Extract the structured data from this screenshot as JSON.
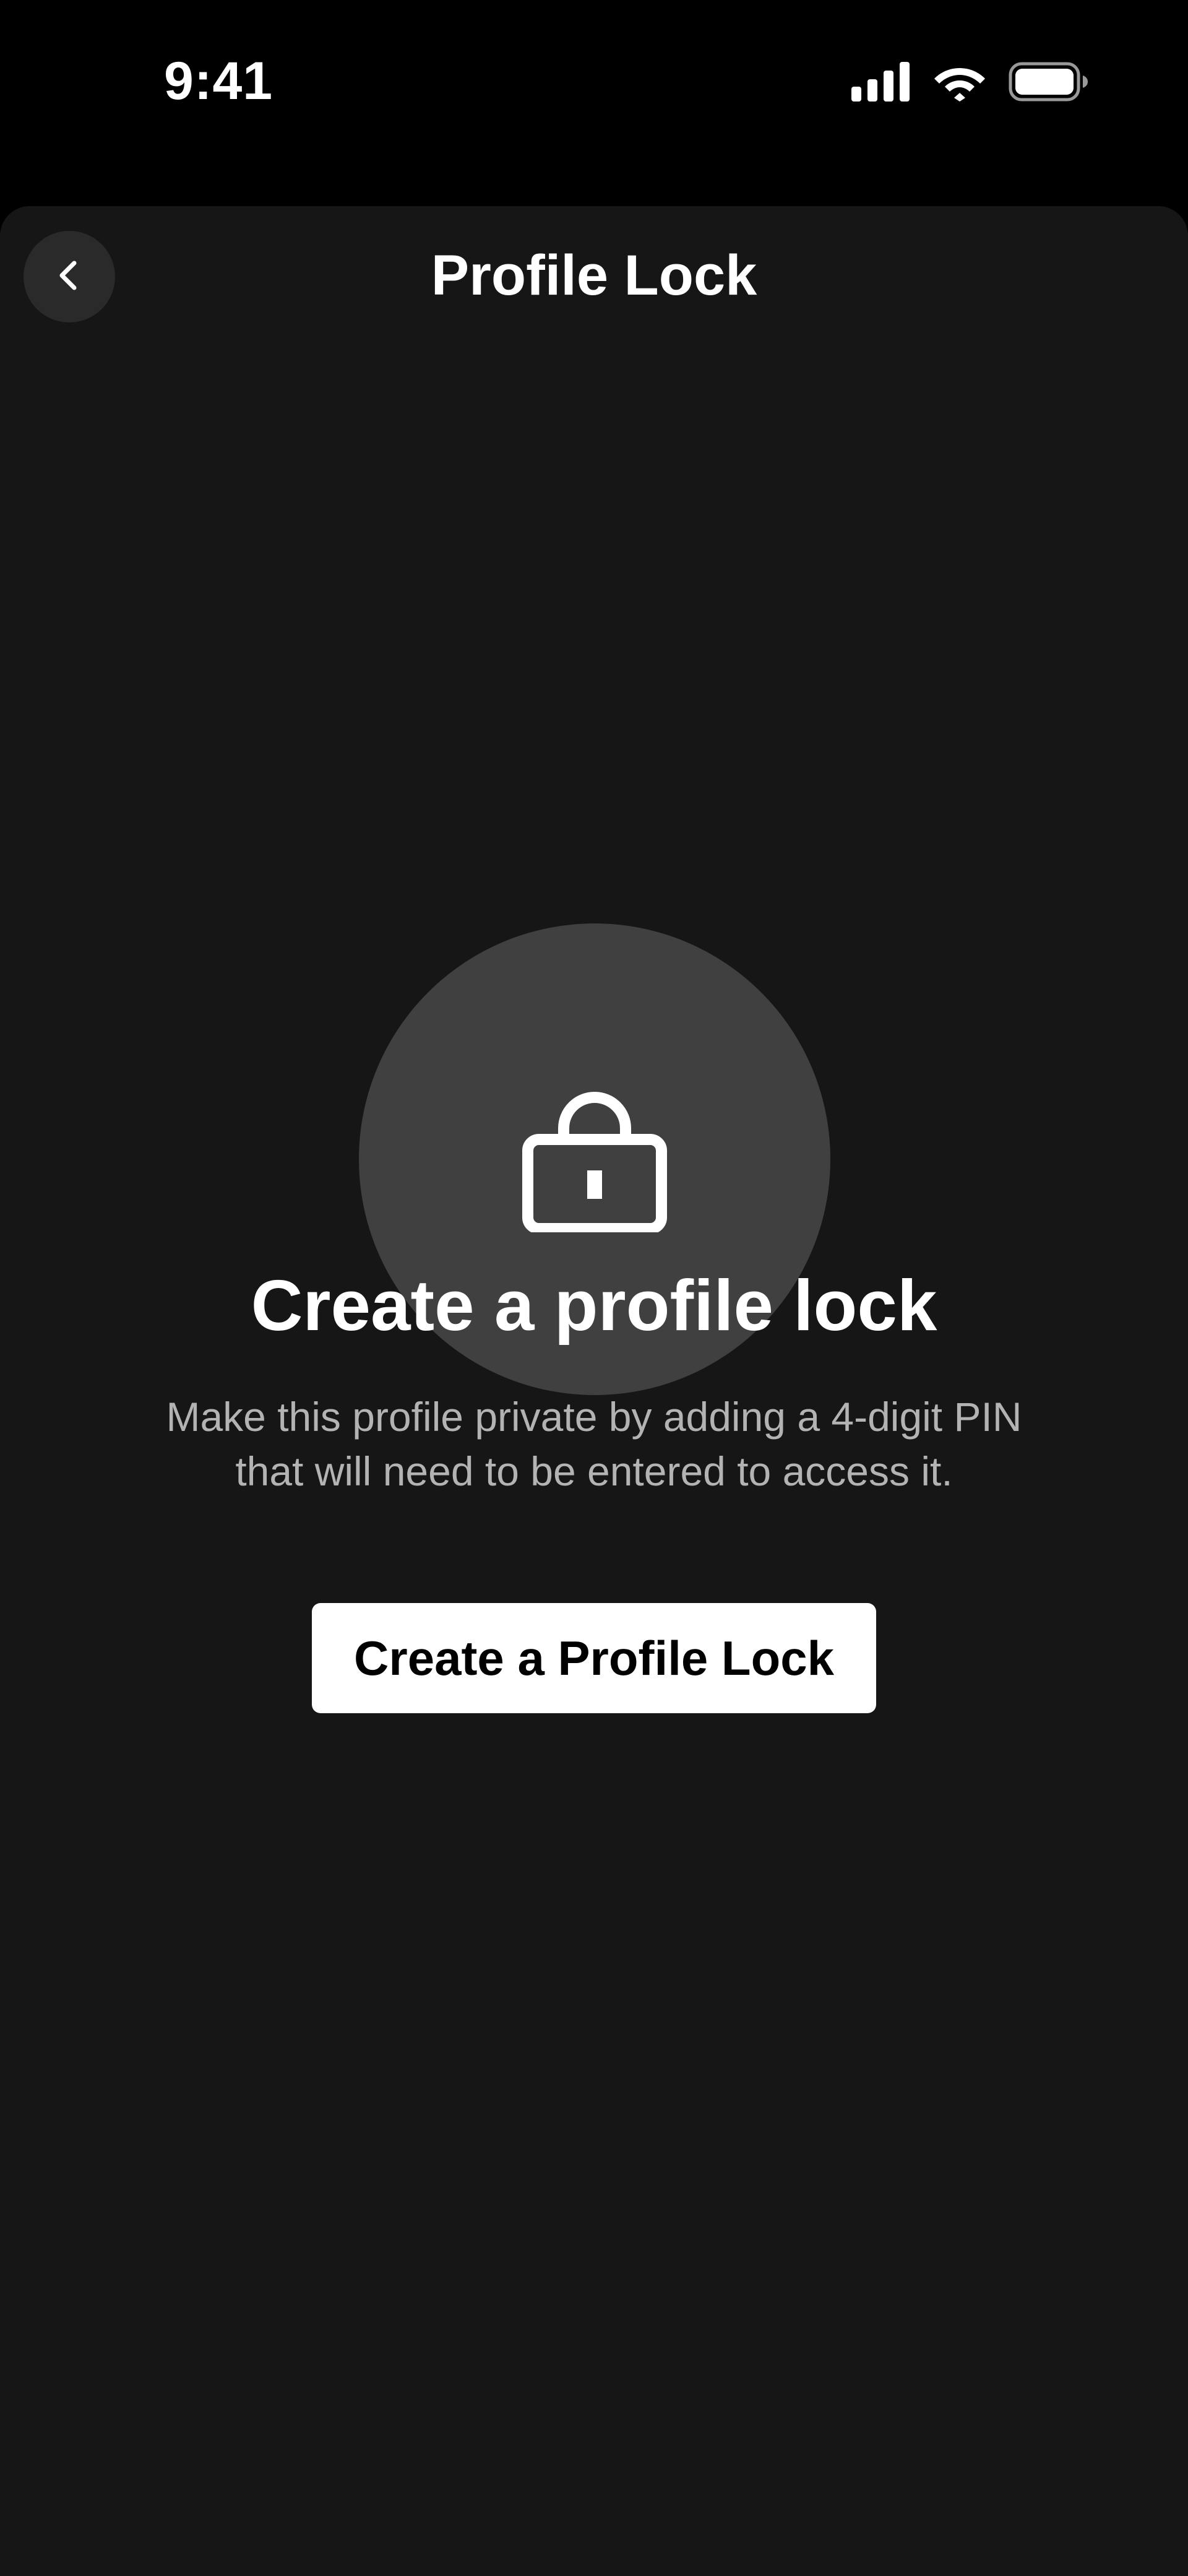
{
  "status_bar": {
    "time": "9:41",
    "icons": [
      "cellular-signal-icon",
      "wifi-icon",
      "battery-icon"
    ]
  },
  "header": {
    "title": "Profile Lock",
    "back_icon": "chevron-left-icon"
  },
  "main": {
    "lock_icon": "padlock-icon",
    "headline": "Create a profile lock",
    "description_lines": [
      "Make this profile private by adding a 4-digit PIN",
      "that will need to be entered to access it."
    ],
    "cta_label": "Create a Profile Lock"
  },
  "colors": {
    "background": "#000000",
    "sheet": "#161616",
    "circle": "#404040",
    "back_button": "#2a2a2a",
    "text_primary": "#ffffff",
    "text_secondary": "#b3b3b3",
    "button_bg": "#ffffff",
    "button_text": "#000000"
  }
}
